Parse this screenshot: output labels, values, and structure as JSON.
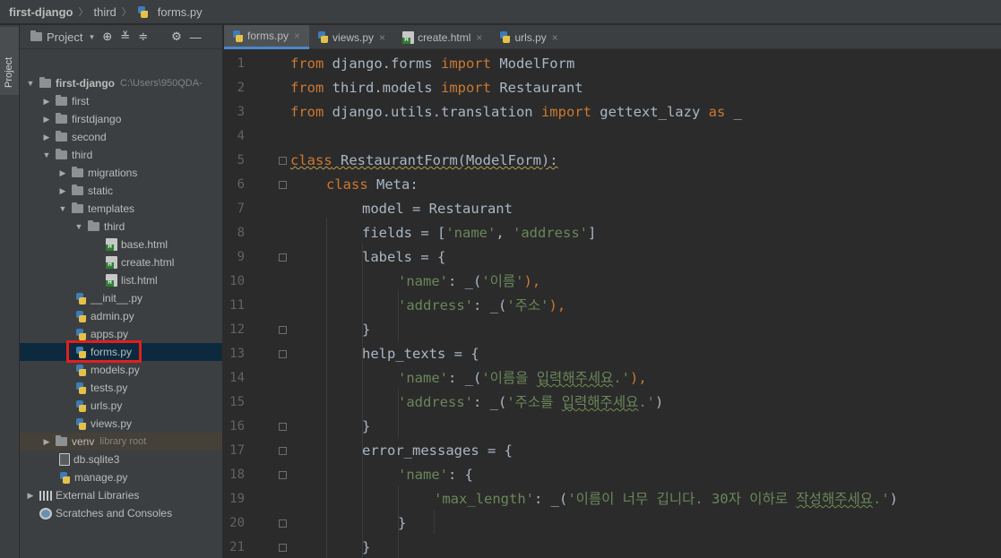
{
  "breadcrumb": [
    "first-django",
    "third",
    "forms.py"
  ],
  "toolstrip": {
    "project_tab": "Project"
  },
  "project_panel": {
    "title": "Project"
  },
  "tree": [
    {
      "label": "first-django",
      "hint": "C:\\Users\\950QDA-"
    },
    {
      "label": "first"
    },
    {
      "label": "firstdjango"
    },
    {
      "label": "second"
    },
    {
      "label": "third"
    },
    {
      "label": "migrations"
    },
    {
      "label": "static"
    },
    {
      "label": "templates"
    },
    {
      "label": "third"
    },
    {
      "label": "base.html"
    },
    {
      "label": "create.html"
    },
    {
      "label": "list.html"
    },
    {
      "label": "__init__.py"
    },
    {
      "label": "admin.py"
    },
    {
      "label": "apps.py"
    },
    {
      "label": "forms.py"
    },
    {
      "label": "models.py"
    },
    {
      "label": "tests.py"
    },
    {
      "label": "urls.py"
    },
    {
      "label": "views.py"
    },
    {
      "label": "venv",
      "hint": "library root"
    },
    {
      "label": "db.sqlite3"
    },
    {
      "label": "manage.py"
    },
    {
      "label": "External Libraries"
    },
    {
      "label": "Scratches and Consoles"
    }
  ],
  "tabs": [
    {
      "label": "forms.py",
      "active": true
    },
    {
      "label": "views.py"
    },
    {
      "label": "create.html"
    },
    {
      "label": "urls.py"
    }
  ],
  "code": {
    "line_numbers": [
      "1",
      "2",
      "3",
      "4",
      "5",
      "6",
      "7",
      "8",
      "9",
      "10",
      "11",
      "12",
      "13",
      "14",
      "15",
      "16",
      "17",
      "18",
      "19",
      "20",
      "21"
    ],
    "l1": {
      "a": "from",
      "b": " django.forms ",
      "c": "import",
      "d": " ModelForm"
    },
    "l2": {
      "a": "from",
      "b": " third.models ",
      "c": "import",
      "d": " Restaurant"
    },
    "l3": {
      "a": "from",
      "b": " django.utils.translation ",
      "c": "import",
      "d": " gettext_lazy ",
      "e": "as",
      "f": " _"
    },
    "l5": {
      "a": "class",
      "b": " RestaurantForm(ModelForm):"
    },
    "l6": {
      "a": "class",
      "b": " Meta:"
    },
    "l7": "model = Restaurant",
    "l8": {
      "a": "fields = [",
      "b": "'name'",
      "c": ", ",
      "d": "'address'",
      "e": "]"
    },
    "l9": "labels = {",
    "l10": {
      "a": "'name'",
      "b": ": _(",
      "c": "'이름'",
      "d": "),"
    },
    "l11": {
      "a": "'address'",
      "b": ": _(",
      "c": "'주소'",
      "d": "),"
    },
    "l12": "}",
    "l13": "help_texts = {",
    "l14": {
      "a": "'name'",
      "b": ": _(",
      "c": "'이름을 ",
      "d": "입력해주세요",
      "e": ".'",
      "f": "),"
    },
    "l15": {
      "a": "'address'",
      "b": ": _(",
      "c": "'주소를 ",
      "d": "입력해주세요",
      "e": ".'",
      "f": ")"
    },
    "l16": "}",
    "l17": "error_messages = {",
    "l18": {
      "a": "'name'",
      "b": ": {"
    },
    "l19": {
      "a": "'max_length'",
      "b": ": _(",
      "c": "'이름이 너무 깁니다. 30자 이하로 ",
      "d": "작성해주세요",
      "e": ".'",
      "f": ")"
    },
    "l20": "}",
    "l21": "}"
  },
  "colors": {
    "keyword": "#cc7832",
    "string": "#6a8759",
    "text": "#a9b7c6",
    "selection_box": "#e11f1f",
    "active_tab_underline": "#4a88c7"
  }
}
